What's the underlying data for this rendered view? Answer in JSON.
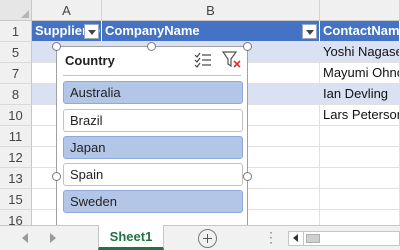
{
  "columns": [
    {
      "letter": "A",
      "header": "SupplierID"
    },
    {
      "letter": "B",
      "header": "CompanyName"
    },
    {
      "letter": "",
      "header": "ContactName"
    }
  ],
  "rows": [
    {
      "num": "1"
    },
    {
      "num": "5",
      "contact": "Yoshi Nagase"
    },
    {
      "num": "7",
      "contact": "Mayumi Ohno"
    },
    {
      "num": "8",
      "contact": "Ian Devling"
    },
    {
      "num": "10",
      "contact": "Lars Peterson"
    },
    {
      "num": "11"
    },
    {
      "num": "12"
    },
    {
      "num": "13"
    },
    {
      "num": "15"
    },
    {
      "num": "16"
    },
    {
      "num": "17"
    }
  ],
  "slicer": {
    "title": "Country",
    "items": [
      {
        "label": "Australia",
        "selected": true
      },
      {
        "label": "Brazil",
        "selected": false
      },
      {
        "label": "Japan",
        "selected": true
      },
      {
        "label": "Spain",
        "selected": false
      },
      {
        "label": "Sweden",
        "selected": true
      }
    ],
    "icons": {
      "multi_select": "multi-select-icon",
      "clear_filter": "clear-filter-icon"
    }
  },
  "sheet_tab": {
    "label": "Sheet1"
  },
  "colors": {
    "header_fill": "#4472c4",
    "band_fill": "#d9e1f2",
    "slicer_selected": "#b4c6e7",
    "sheet_tab_accent": "#217346"
  }
}
